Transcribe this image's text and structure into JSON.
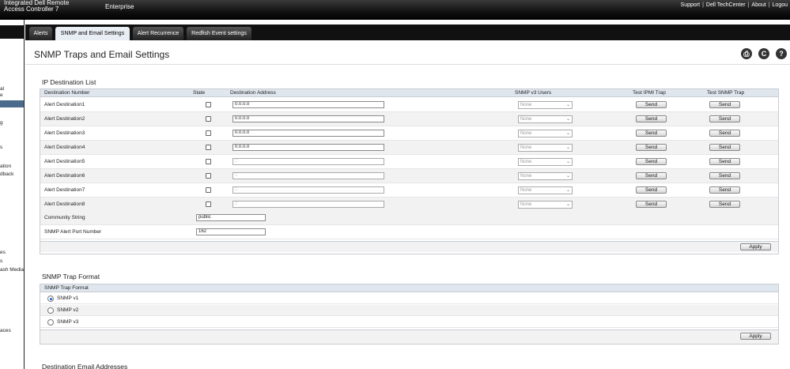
{
  "header": {
    "brand_line1": "Integrated Dell Remote",
    "brand_line2": "Access Controller 7",
    "edition": "Enterprise",
    "links": [
      "Support",
      "Dell TechCenter",
      "About",
      "Logou"
    ]
  },
  "sidebar": {
    "items": [
      "al",
      "e",
      "g",
      "s",
      "ation",
      "dback",
      "es",
      "s",
      "ash Media",
      "aces"
    ]
  },
  "tabs": [
    "Alerts",
    "SNMP and Email Settings",
    "Alert Recurrence",
    "Redfish Event settings"
  ],
  "active_tab": "SNMP and Email Settings",
  "page": {
    "title": "SNMP Traps and Email Settings",
    "tools": [
      {
        "name": "print-icon",
        "glyph": "⎙"
      },
      {
        "name": "refresh-icon",
        "glyph": "C"
      },
      {
        "name": "help-icon",
        "glyph": "?"
      }
    ]
  },
  "ip_list": {
    "section_title": "IP Destination List",
    "columns": [
      "Destination Number",
      "State",
      "Destination Address",
      "SNMP v3 Users",
      "Test IPMI Trap",
      "Test SNMP Trap"
    ],
    "rows": [
      {
        "name": "Alert Destination1",
        "address": "0.0.0.0",
        "user": "None",
        "ipmi": "Send",
        "snmp": "Send"
      },
      {
        "name": "Alert Destination2",
        "address": "0.0.0.0",
        "user": "None",
        "ipmi": "Send",
        "snmp": "Send"
      },
      {
        "name": "Alert Destination3",
        "address": "0.0.0.0",
        "user": "None",
        "ipmi": "Send",
        "snmp": "Send"
      },
      {
        "name": "Alert Destination4",
        "address": "0.0.0.0",
        "user": "None",
        "ipmi": "Send",
        "snmp": "Send"
      },
      {
        "name": "Alert Destination5",
        "address": "::",
        "user": "None",
        "ipmi": "Send",
        "snmp": "Send"
      },
      {
        "name": "Alert Destination6",
        "address": "::",
        "user": "None",
        "ipmi": "Send",
        "snmp": "Send"
      },
      {
        "name": "Alert Destination7",
        "address": "::",
        "user": "None",
        "ipmi": "Send",
        "snmp": "Send"
      },
      {
        "name": "Alert Destination8",
        "address": "::",
        "user": "None",
        "ipmi": "Send",
        "snmp": "Send"
      }
    ],
    "community_label": "Community String",
    "community_value": "public",
    "port_label": "SNMP Alert Port Number",
    "port_value": "162",
    "apply": "Apply"
  },
  "trap_format": {
    "section_title": "SNMP Trap Format",
    "header": "SNMP Trap Format",
    "options": [
      "SNMP v1",
      "SNMP v2",
      "SNMP v3"
    ],
    "selected": "SNMP v1",
    "apply": "Apply"
  },
  "email": {
    "section_title": "Destination Email Addresses"
  }
}
